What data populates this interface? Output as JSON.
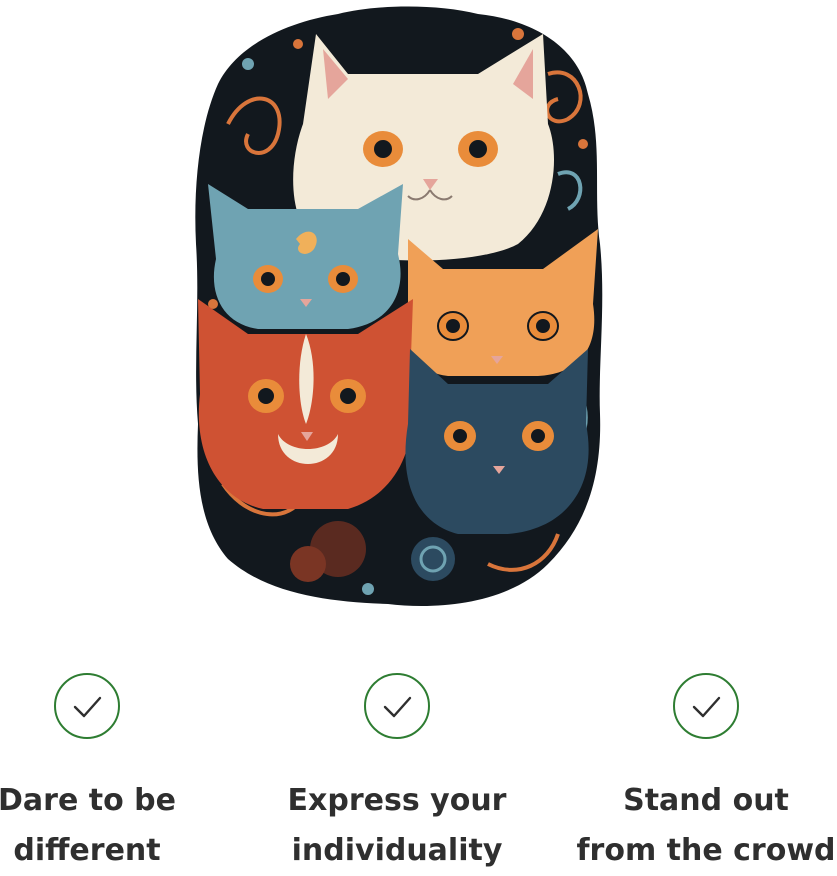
{
  "illustration": {
    "subject": "five-cats-sticker-illustration",
    "colors": {
      "outline": "#12181e",
      "white_cat": "#f3ead8",
      "blue_cat": "#6fa3b2",
      "orange_cat": "#f0a057",
      "red_cat": "#cf5233",
      "dark_blue_cat": "#2c4a60",
      "eye": "#e98c3a",
      "accent_swirl": "#d9753b"
    }
  },
  "features": [
    {
      "icon": "check-circle-icon",
      "line1": "Dare to be",
      "line2": "different"
    },
    {
      "icon": "check-circle-icon",
      "line1": "Express your",
      "line2": "individuality"
    },
    {
      "icon": "check-circle-icon",
      "line1": "Stand out",
      "line2": "from the crowd"
    }
  ],
  "theme": {
    "check_color": "#2e7d32",
    "text_color": "#2f2f2f"
  }
}
